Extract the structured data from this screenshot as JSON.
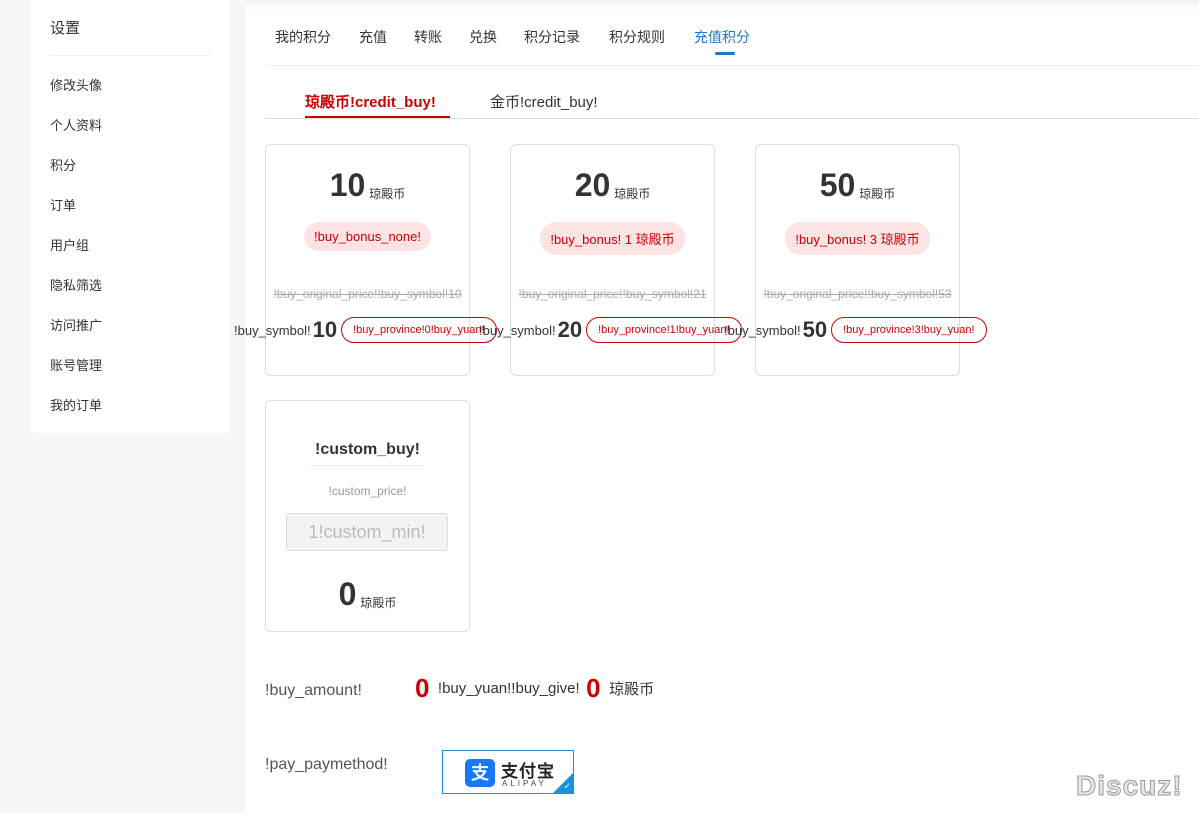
{
  "sidebar": {
    "title": "设置",
    "items": [
      {
        "label": "修改头像"
      },
      {
        "label": "个人资料"
      },
      {
        "label": "积分"
      },
      {
        "label": "订单"
      },
      {
        "label": "用户组"
      },
      {
        "label": "隐私筛选"
      },
      {
        "label": "访问推广"
      },
      {
        "label": "账号管理"
      },
      {
        "label": "我的订单"
      }
    ]
  },
  "nav": {
    "tabs": [
      {
        "label": "我的积分"
      },
      {
        "label": "充值"
      },
      {
        "label": "转账"
      },
      {
        "label": "兑换"
      },
      {
        "label": "积分记录"
      },
      {
        "label": "积分规则"
      },
      {
        "label": "充值积分"
      }
    ],
    "active_tab": "充值积分"
  },
  "subtabs": [
    {
      "label": "琼殿币!credit_buy!"
    },
    {
      "label": "金币!credit_buy!"
    }
  ],
  "packages": [
    {
      "amount": "10",
      "unit": "琼殿币",
      "bonus": "!buy_bonus_none!",
      "original": "!buy_original_price!!buy_symbol!10",
      "symbol": "!buy_symbol!",
      "price": "10",
      "province": "!buy_province!0!buy_yuan!"
    },
    {
      "amount": "20",
      "unit": "琼殿币",
      "bonus": "!buy_bonus! 1 琼殿币",
      "original": "!buy_original_price!!buy_symbol!21",
      "symbol": "!buy_symbol!",
      "price": "20",
      "province": "!buy_province!1!buy_yuan!"
    },
    {
      "amount": "50",
      "unit": "琼殿币",
      "bonus": "!buy_bonus! 3 琼殿币",
      "original": "!buy_original_price!!buy_symbol!53",
      "symbol": "!buy_symbol!",
      "price": "50",
      "province": "!buy_province!3!buy_yuan!"
    }
  ],
  "custom": {
    "title": "!custom_buy!",
    "price_label": "!custom_price!",
    "input_placeholder": "1!custom_min!",
    "amount": "0",
    "unit": "琼殿币"
  },
  "summary": {
    "label": "!buy_amount!",
    "amount": "0",
    "yuan_give": "!buy_yuan!!buy_give!",
    "give_amount": "0",
    "unit": "琼殿币"
  },
  "payment": {
    "label": "!pay_paymethod!",
    "alipay_cn": "支付宝",
    "alipay_en": "ALIPAY",
    "alipay_logo_glyph": "支",
    "check_glyph": "✓"
  },
  "watermark": "Discuz!",
  "colors": {
    "accent": "#1e78c8",
    "red": "#cc0000",
    "alipay_blue": "#1677ff"
  }
}
